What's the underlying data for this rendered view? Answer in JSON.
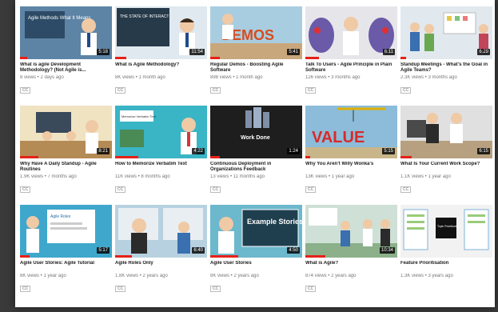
{
  "videos": [
    {
      "title": "What is agile Development Methodology? (Not Agile is...",
      "views": "8 views",
      "age": "2 days ago",
      "badge": "CC",
      "duration": "5:18",
      "thumb_text": "Agile Methods What It Means",
      "progress": 0.08,
      "bg": "#5f86a8"
    },
    {
      "title": "What is Agile Methodology?",
      "views": "8K views",
      "age": "1 month ago",
      "badge": "CC",
      "duration": "11:54",
      "thumb_text": "THE STATE OF INTERACT",
      "progress": 0.12,
      "bg": "#263a4a"
    },
    {
      "title": "Regular Demos - Boosting Agile Software",
      "views": "898 views",
      "age": "1 month ago",
      "badge": "CC",
      "duration": "5:41",
      "thumb_text": "DEMOS",
      "progress": 0.1,
      "bg": "#9fc4d8"
    },
    {
      "title": "Talk To Users - Agile Principle in Plain Software",
      "views": "126 views",
      "age": "3 months ago",
      "badge": "CC",
      "duration": "6:11",
      "thumb_text": "",
      "progress": 0.15,
      "bg": "#6f6fb0"
    },
    {
      "title": "Standup Meetings - What's the Goal in Agile Teams?",
      "views": "2.3K views",
      "age": "3 months ago",
      "badge": "CC",
      "duration": "6:29",
      "thumb_text": "",
      "progress": 0.06,
      "bg": "#dde6ee"
    },
    {
      "title": "Why Have A Daily Standup - Agile Routines",
      "views": "1.9K views",
      "age": "7 months ago",
      "badge": "CC",
      "duration": "8:21",
      "thumb_text": "",
      "progress": 0.2,
      "bg": "#c8b68a"
    },
    {
      "title": "How to Memorize Verbatim Text",
      "views": "11K views",
      "age": "8 months ago",
      "badge": "CC",
      "duration": "4:22",
      "thumb_text": "Memorize Verbatim Text",
      "progress": 0.25,
      "bg": "#3cb6c6"
    },
    {
      "title": "Continuous Deployment in Organizations Feedback",
      "views": "13 views",
      "age": "11 months ago",
      "badge": "CC",
      "duration": "1:24",
      "thumb_text": "Work Done",
      "progress": 0.1,
      "bg": "#1e1e1e"
    },
    {
      "title": "Why You Aren't Willy Wonka's",
      "views": "13K views",
      "age": "1 year ago",
      "badge": "CC",
      "duration": "5:15",
      "thumb_text": "VALUE",
      "progress": 0.05,
      "bg": "#8cbcd9"
    },
    {
      "title": "What Is Your Current Work Scope?",
      "views": "1.1K views",
      "age": "1 year ago",
      "badge": "CC",
      "duration": "6:15",
      "thumb_text": "",
      "progress": 0.12,
      "bg": "#dcdcdc"
    },
    {
      "title": "Agile User Stories: Agile Tutorial",
      "views": "8K views",
      "age": "1 year ago",
      "badge": "CC",
      "duration": "5:17",
      "thumb_text": "Agile Roles",
      "progress": 0.1,
      "bg": "#3fa7cc"
    },
    {
      "title": "Agile Roles Only",
      "views": "1.8K views",
      "age": "2 years ago",
      "badge": "CC",
      "duration": "6:40",
      "thumb_text": "",
      "progress": 0.18,
      "bg": "#b8d1e0"
    },
    {
      "title": "Agile User Stories",
      "views": "8K views",
      "age": "2 years ago",
      "badge": "CC",
      "duration": "4:50",
      "thumb_text": "Example Stories",
      "progress": 0.3,
      "bg": "#6cb8cc"
    },
    {
      "title": "What is Agile?",
      "views": "874 views",
      "age": "2 years ago",
      "badge": "CC",
      "duration": "10:34",
      "thumb_text": "",
      "progress": 0.22,
      "bg": "#9fb9a6"
    },
    {
      "title": "Feature Prioritisation",
      "views": "1.3K views",
      "age": "3 years ago",
      "badge": "",
      "duration": "",
      "thumb_text": "Topic Prioritization",
      "progress": 0.0,
      "bg": "#f2f2f2"
    }
  ]
}
